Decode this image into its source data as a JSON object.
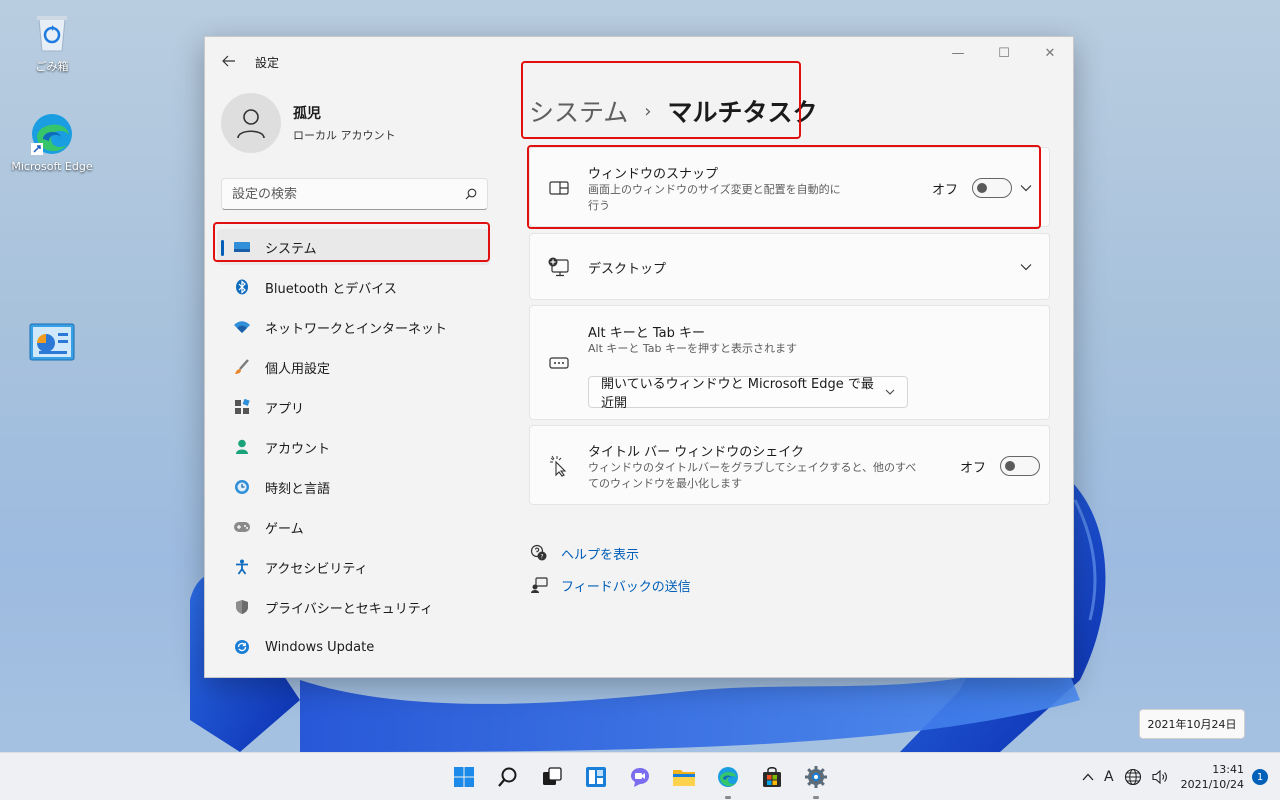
{
  "desktop": {
    "icons": [
      {
        "label": "ごみ箱",
        "icon": "recycle-bin-icon"
      },
      {
        "label": "Microsoft Edge",
        "icon": "edge-icon"
      },
      {
        "label": "",
        "icon": "control-panel-icon"
      }
    ]
  },
  "window": {
    "title": "設定",
    "controls": {
      "minimize": "—",
      "maximize": "☐",
      "close": "✕"
    }
  },
  "profile": {
    "name": "孤児",
    "account_type": "ローカル アカウント"
  },
  "search": {
    "placeholder": "設定の検索"
  },
  "sidebar": {
    "items": [
      {
        "label": "システム",
        "icon": "system-icon",
        "active": true
      },
      {
        "label": "Bluetooth とデバイス",
        "icon": "bluetooth-icon"
      },
      {
        "label": "ネットワークとインターネット",
        "icon": "network-icon"
      },
      {
        "label": "個人用設定",
        "icon": "brush-icon"
      },
      {
        "label": "アプリ",
        "icon": "apps-icon"
      },
      {
        "label": "アカウント",
        "icon": "account-icon"
      },
      {
        "label": "時刻と言語",
        "icon": "time-language-icon"
      },
      {
        "label": "ゲーム",
        "icon": "gaming-icon"
      },
      {
        "label": "アクセシビリティ",
        "icon": "accessibility-icon"
      },
      {
        "label": "プライバシーとセキュリティ",
        "icon": "shield-icon"
      },
      {
        "label": "Windows Update",
        "icon": "update-icon"
      }
    ]
  },
  "breadcrumb": {
    "parent": "システム",
    "separator": "›",
    "current": "マルチタスク"
  },
  "cards": {
    "snap": {
      "title": "ウィンドウのスナップ",
      "desc_line1": "画面上のウィンドウのサイズ変更と配置を自動的に",
      "desc_line2": "行う",
      "state": "オフ",
      "on": false
    },
    "desktop": {
      "title": "デスクトップ"
    },
    "alttab": {
      "title": "Alt キーと Tab キー",
      "desc": "Alt キーと Tab キーを押すと表示されます",
      "selected": "開いているウィンドウと Microsoft Edge で最近開"
    },
    "shake": {
      "title": "タイトル バー ウィンドウのシェイク",
      "desc_line1": "ウィンドウのタイトルバーをグラブしてシェイクすると、他のすべ",
      "desc_line2": "てのウィンドウを最小化します",
      "state": "オフ",
      "on": false
    }
  },
  "help": {
    "show_help": "ヘルプを表示",
    "feedback": "フィードバックの送信"
  },
  "date_tooltip": "2021年10月24日",
  "taskbar": {
    "apps": [
      "start-icon",
      "search-icon",
      "task-view-icon",
      "widgets-icon",
      "chat-icon",
      "file-explorer-icon",
      "edge-icon",
      "store-icon",
      "settings-icon"
    ],
    "tray": {
      "ime": "A",
      "time": "13:41",
      "date": "2021/10/24",
      "notifications": "1"
    }
  },
  "colors": {
    "accent": "#005fb8",
    "highlight_box": "#e01010"
  }
}
